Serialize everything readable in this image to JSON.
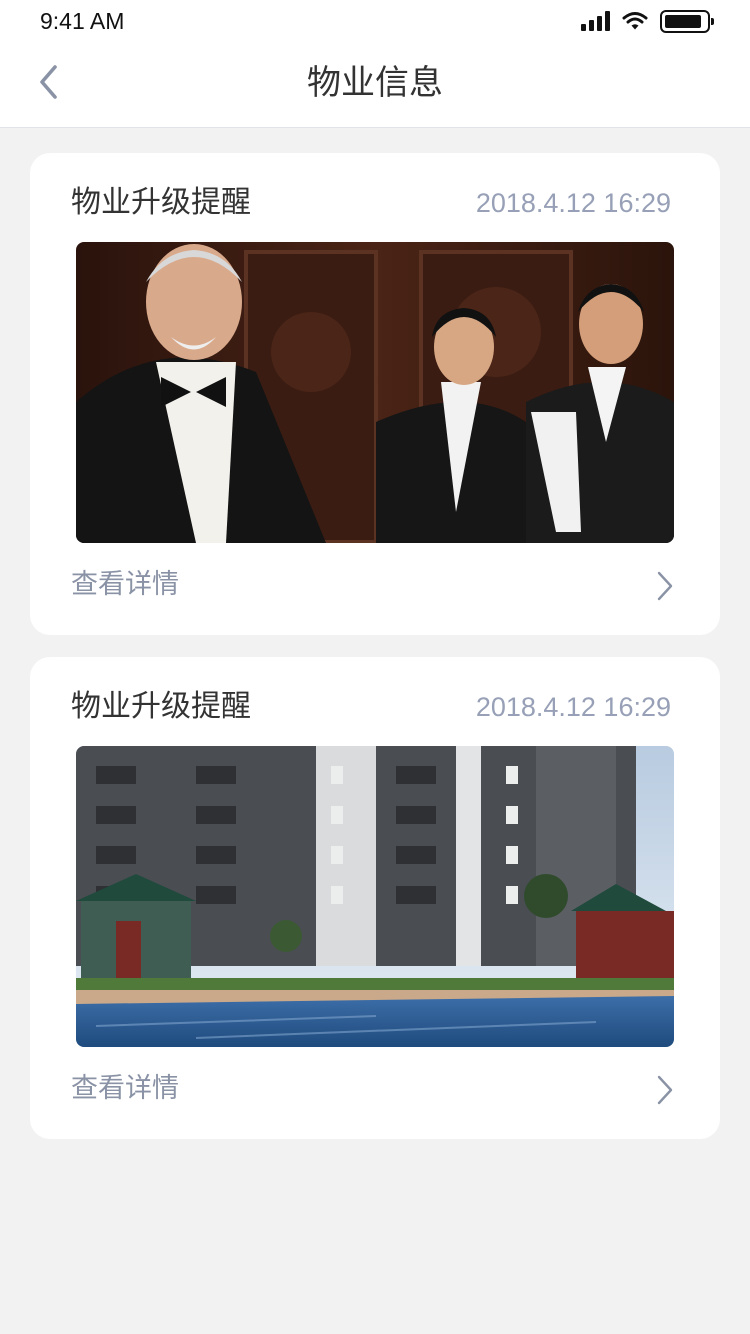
{
  "status_bar": {
    "time": "9:41 AM"
  },
  "header": {
    "title": "物业信息",
    "back_icon": "chevron-left-icon"
  },
  "cards": [
    {
      "title": "物业升级提醒",
      "time": "2018.4.12 16:29",
      "image": "staff-photo",
      "link": "查看详情",
      "link_icon": "chevron-right-icon"
    },
    {
      "title": "物业升级提醒",
      "time": "2018.4.12 16:29",
      "image": "building-pool-photo",
      "link": "查看详情",
      "link_icon": "chevron-right-icon"
    }
  ],
  "colors": {
    "background": "#f2f2f3",
    "card": "#ffffff",
    "title_text": "#333333",
    "meta_text": "#97a0b6",
    "accent_icon": "#8a93a6"
  }
}
